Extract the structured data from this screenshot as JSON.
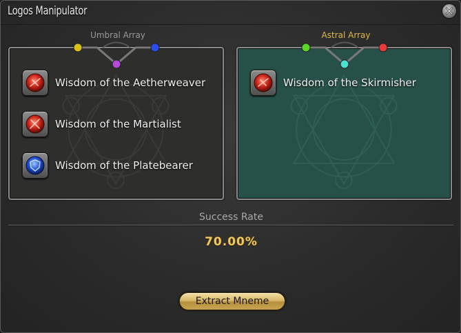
{
  "window": {
    "title": "Logos Manipulator"
  },
  "umbral": {
    "label": "Umbral Array",
    "items": [
      {
        "label": "Wisdom of the Aetherweaver",
        "icon": "red-crystal-icon"
      },
      {
        "label": "Wisdom of the Martialist",
        "icon": "red-crystal-icon"
      },
      {
        "label": "Wisdom of the Platebearer",
        "icon": "blue-crystal-icon"
      }
    ]
  },
  "astral": {
    "label": "Astral Array",
    "items": [
      {
        "label": "Wisdom of the Skirmisher",
        "icon": "red-crystal-icon"
      }
    ]
  },
  "success": {
    "label": "Success Rate",
    "value": "70.00%"
  },
  "actions": {
    "extract_label": "Extract Mneme"
  },
  "colors": {
    "astral_accent": "#e0b84a",
    "success_value": "#f0c860",
    "umbral_panel": "#2e2e2c",
    "astral_panel": "#275048"
  }
}
